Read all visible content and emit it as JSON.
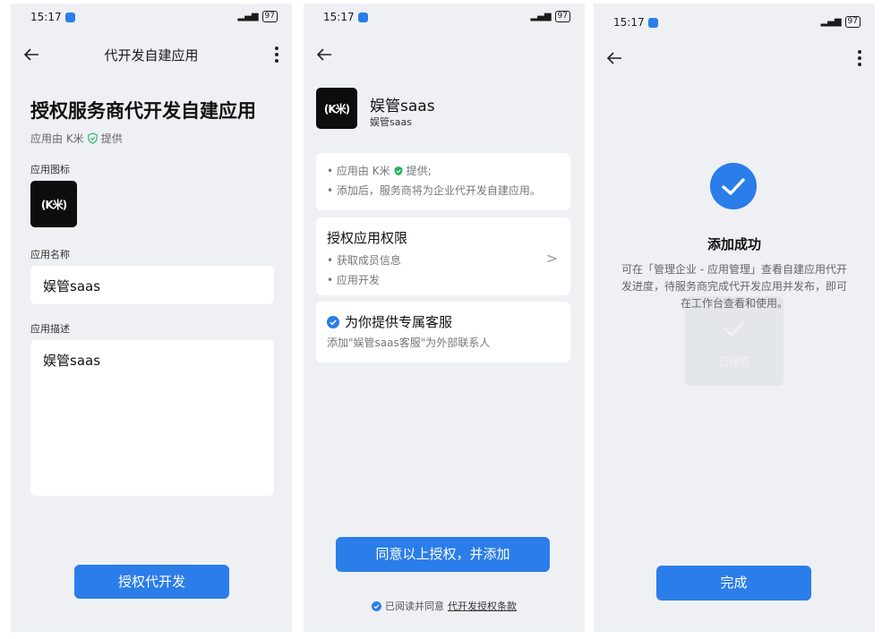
{
  "status": {
    "time": "15:17",
    "battery": "97"
  },
  "screen1": {
    "nav_title": "代开发自建应用",
    "heading": "授权服务商代开发自建应用",
    "provider_prefix": "应用由 K米",
    "provider_suffix": "提供",
    "icon_label": "应用图标",
    "logo_text": "(K米)",
    "name_label": "应用名称",
    "name_value": "娱管saas",
    "desc_label": "应用描述",
    "desc_value": "娱管saas",
    "button": "授权代开发"
  },
  "screen2": {
    "app_name": "娱管saas",
    "app_sub": "娱管saas",
    "logo_text": "(K米)",
    "info_1_prefix": "• 应用由 K米",
    "info_1_suffix": "提供;",
    "info_2": "• 添加后，服务商将为企业代开发自建应用。",
    "perm_title": "授权应用权限",
    "perm_1": "• 获取成员信息",
    "perm_2": "• 应用开发",
    "service_title": "为你提供专属客服",
    "service_desc": "添加\"娱管saas客服\"为外部联系人",
    "button": "同意以上授权，并添加",
    "agree_prefix": "已阅读并同意",
    "agree_link": "代开发授权条款"
  },
  "screen3": {
    "title": "添加成功",
    "desc": "可在「管理企业 - 应用管理」查看自建应用代开发进度，待服务商完成代开发应用并发布，即可在工作台查看和使用。",
    "ghost_label": "已授权",
    "button": "完成"
  },
  "colors": {
    "accent": "#2b7de9",
    "verified": "#22b35e",
    "background": "#eef0f4"
  }
}
